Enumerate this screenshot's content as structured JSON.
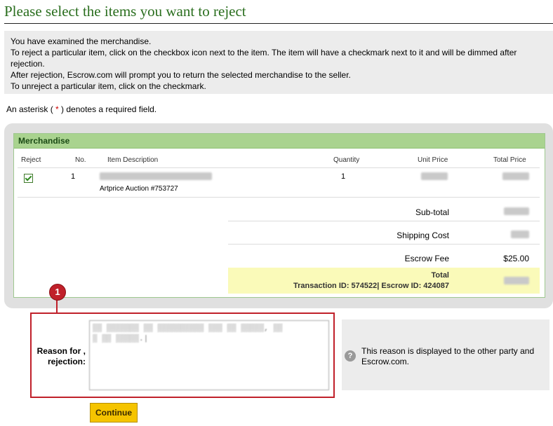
{
  "page": {
    "title": "Please select the items you want to reject"
  },
  "info": {
    "lines": [
      "You have examined the merchandise.",
      "To reject a particular item, click on the checkbox icon next to the item. The item will have a checkmark next to it and will be dimmed after rejection.",
      "After rejection, Escrow.com will prompt you to return the selected merchandise to the seller.",
      "To unreject a particular item, click on the checkmark."
    ]
  },
  "required_note": {
    "prefix": "An asterisk (",
    "symbol": "*",
    "suffix": ")  denotes a required field."
  },
  "merchandise": {
    "heading": "Merchandise",
    "columns": {
      "reject": "Reject",
      "no": "No.",
      "description": "Item Description",
      "quantity": "Quantity",
      "unit_price": "Unit Price",
      "total_price": "Total Price"
    },
    "items": [
      {
        "checked": true,
        "no": "1",
        "sub_description": "Artprice Auction #753727",
        "quantity": "1"
      }
    ],
    "summary": {
      "subtotal_label": "Sub-total",
      "shipping_label": "Shipping Cost",
      "escrow_fee_label": "Escrow Fee",
      "escrow_fee_value": "$25.00",
      "total_label": "Total",
      "transaction_line": "Transaction ID: 574522| Escrow ID: 424087"
    }
  },
  "reason": {
    "label_line1": "Reason for",
    "label_line2": "rejection:",
    "asterisk": ",",
    "help_text": "This reason is displayed to the other party and Escrow.com."
  },
  "callout": {
    "number": "1"
  },
  "actions": {
    "continue_label": "Continue"
  },
  "colors": {
    "title_green": "#2a6e1e",
    "merch_header": "#a9d38f",
    "total_highlight": "#fafab9",
    "callout_red": "#c0202a",
    "button_yellow": "#f5c400"
  }
}
